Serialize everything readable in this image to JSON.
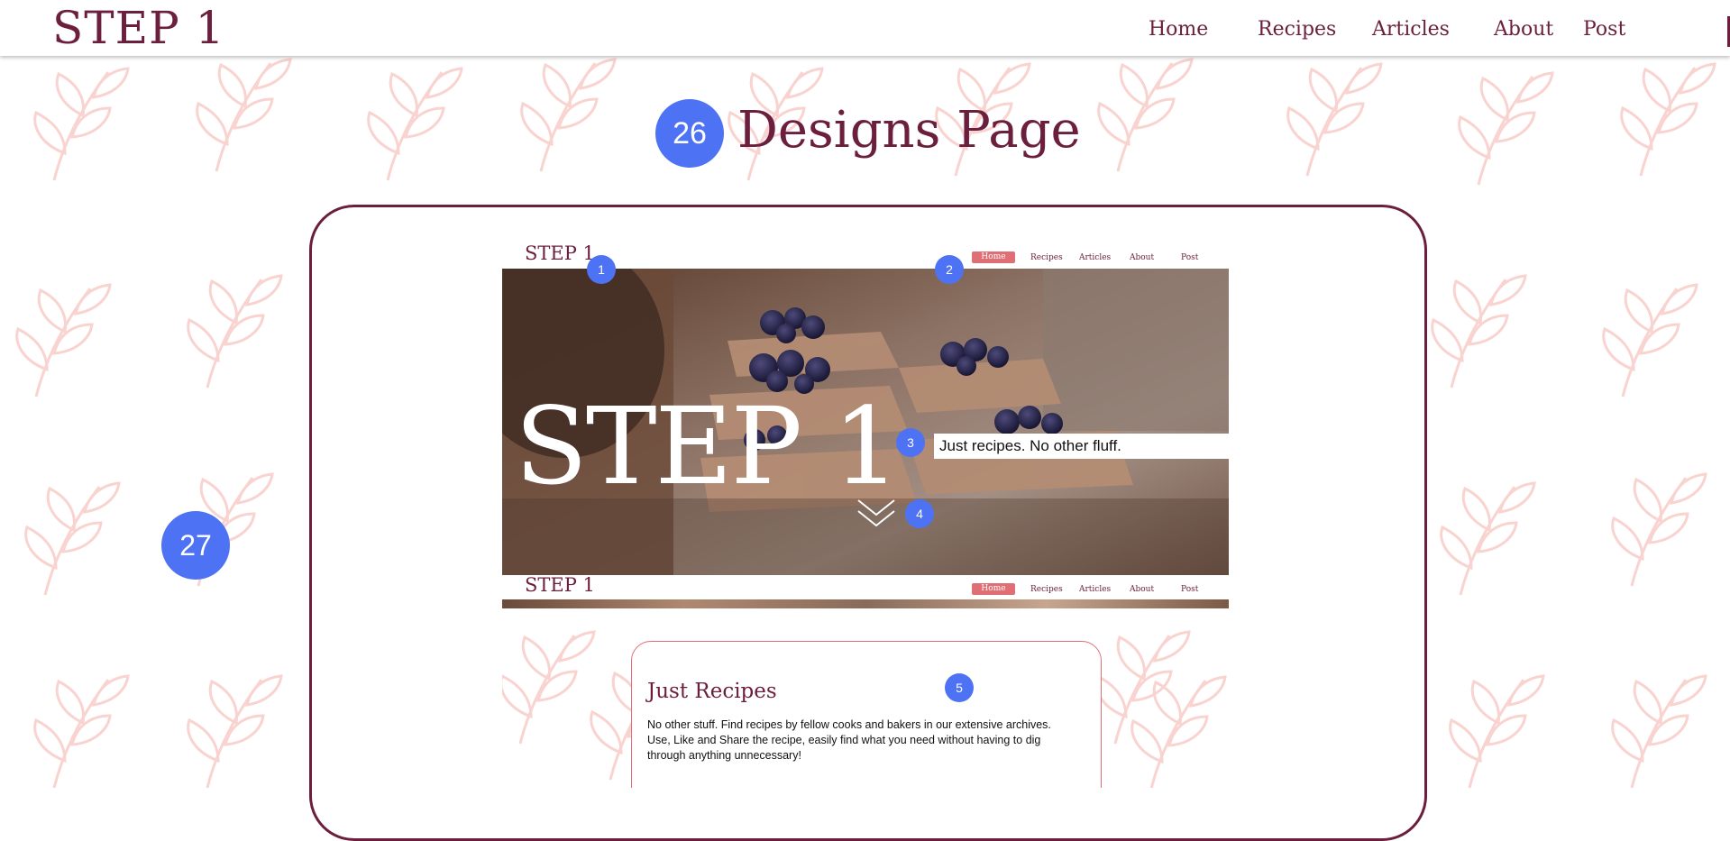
{
  "site": {
    "logo": "STEP 1"
  },
  "nav": {
    "items": [
      "Home",
      "Recipes",
      "Articles",
      "About",
      "Post"
    ]
  },
  "page_title": "Designs Page",
  "badges": {
    "title_number": "26",
    "section_number": "27",
    "annotations": [
      "1",
      "2",
      "3",
      "4",
      "5"
    ]
  },
  "mockup": {
    "logo": "STEP 1",
    "nav": [
      "Home",
      "Recipes",
      "Articles",
      "About",
      "Post"
    ],
    "active_nav": "Home",
    "hero_title": "STEP 1",
    "tagline": "Just recipes. No other fluff.",
    "sticky_logo": "STEP 1",
    "sticky_nav": [
      "Home",
      "Recipes",
      "Articles",
      "About",
      "Post"
    ],
    "card": {
      "title": "Just Recipes",
      "body": "No other stuff. Find recipes by fellow cooks and bakers in our extensive archives. Use, Like and Share the recipe, easily find what you need without having to dig through anything unnecessary!"
    }
  },
  "colors": {
    "brand": "#6b1f3d",
    "accent": "#e06f75",
    "badge": "#4d73f4",
    "pattern": "#f9d3cf"
  },
  "icons": {
    "scroll_down": "double-chevron-down-icon"
  }
}
